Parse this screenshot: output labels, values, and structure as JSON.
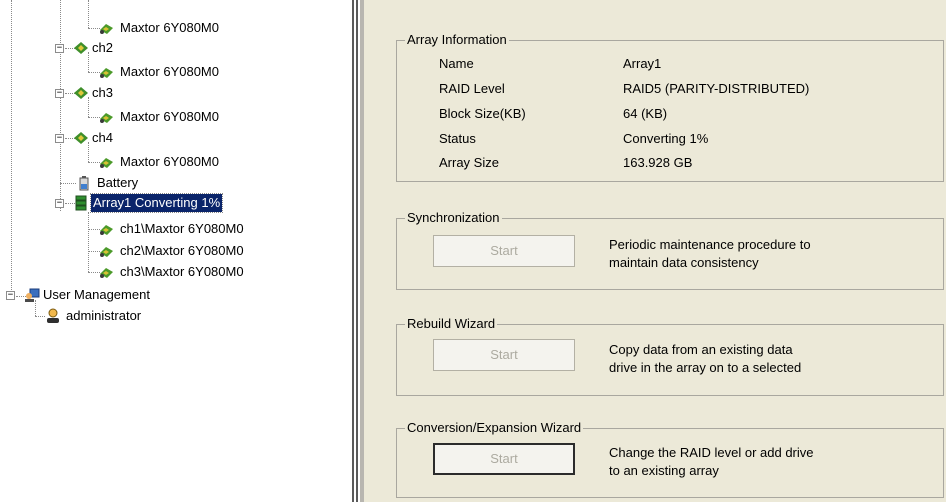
{
  "tree": {
    "nodes": [
      {
        "label": "Maxtor 6Y080M0"
      },
      {
        "label": "ch2"
      },
      {
        "label": "Maxtor 6Y080M0"
      },
      {
        "label": "ch3"
      },
      {
        "label": "Maxtor 6Y080M0"
      },
      {
        "label": "ch4"
      },
      {
        "label": "Maxtor 6Y080M0"
      },
      {
        "label": "Battery"
      },
      {
        "label": "Array1 Converting 1%"
      },
      {
        "label": "ch1\\Maxtor 6Y080M0"
      },
      {
        "label": "ch2\\Maxtor 6Y080M0"
      },
      {
        "label": "ch3\\Maxtor 6Y080M0"
      },
      {
        "label": "User Management"
      },
      {
        "label": "administrator"
      }
    ]
  },
  "array_info": {
    "legend": "Array Information",
    "rows": [
      {
        "key": "Name",
        "value": "Array1"
      },
      {
        "key": "RAID Level",
        "value": "RAID5 (PARITY-DISTRIBUTED)"
      },
      {
        "key": "Block Size(KB)",
        "value": "64 (KB)"
      },
      {
        "key": "Status",
        "value": "Converting 1%"
      },
      {
        "key": "Array Size",
        "value": "163.928 GB"
      }
    ]
  },
  "sync": {
    "legend": "Synchronization",
    "button": "Start",
    "desc1": "Periodic maintenance procedure to",
    "desc2": "maintain data consistency"
  },
  "rebuild": {
    "legend": "Rebuild Wizard",
    "button": "Start",
    "desc1": "Copy data from an existing data",
    "desc2": "drive in the array on to a selected"
  },
  "conversion": {
    "legend": "Conversion/Expansion Wizard",
    "button": "Start",
    "desc1": "Change the RAID level or add drive",
    "desc2": "to an existing array"
  }
}
